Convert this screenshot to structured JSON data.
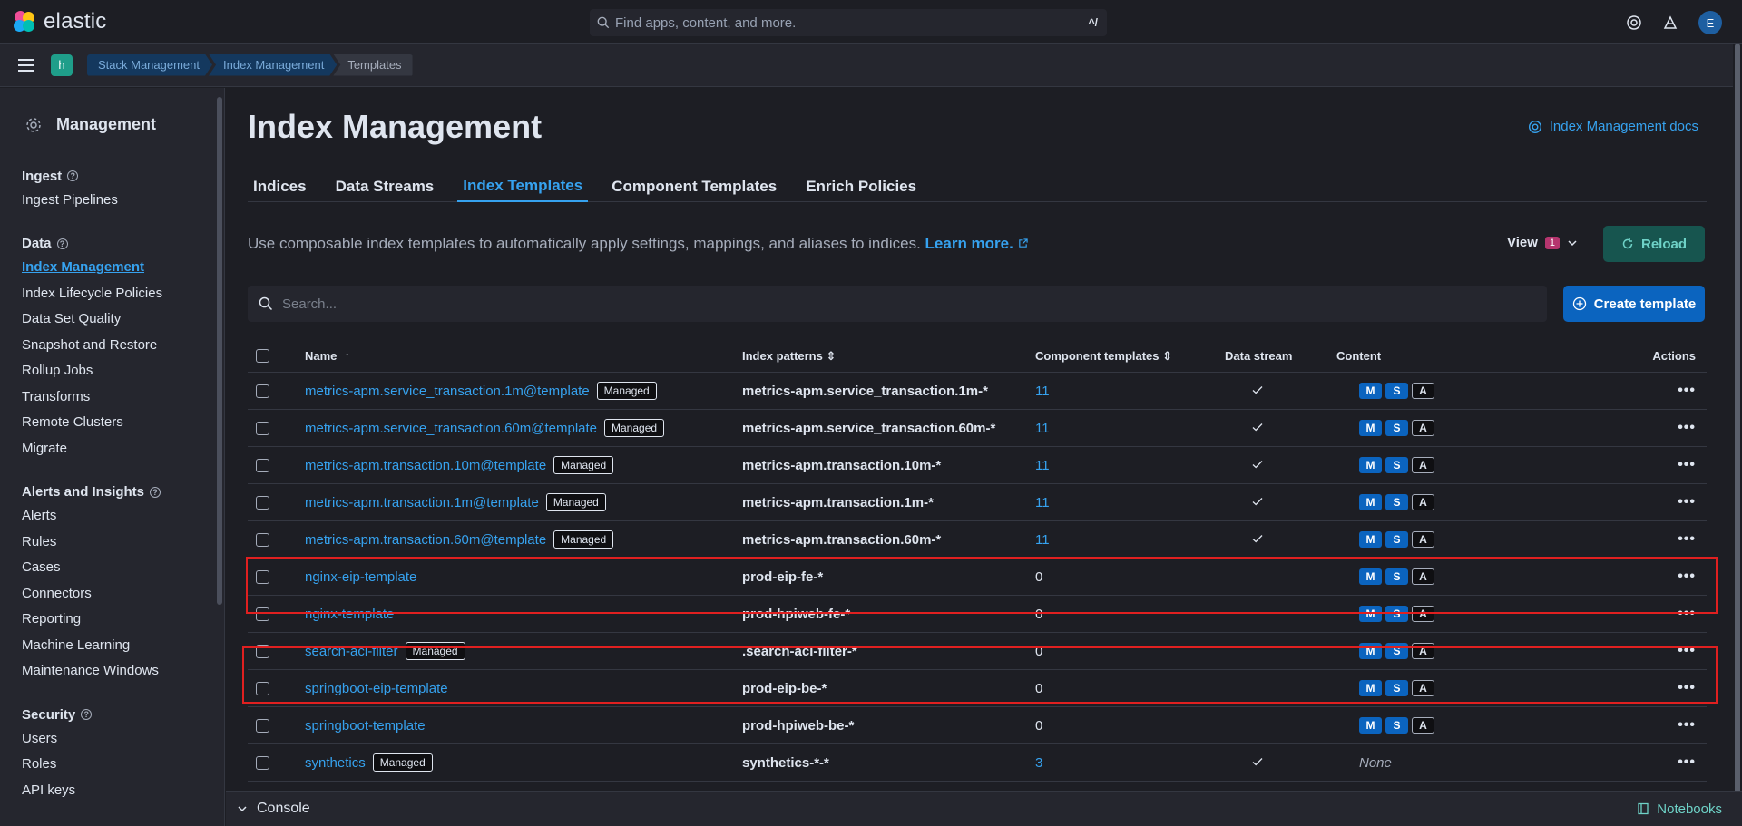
{
  "app": {
    "logo_text": "elastic",
    "search_placeholder": "Find apps, content, and more.",
    "search_shortcut": "^/",
    "avatar_letter": "E",
    "space_letter": "h"
  },
  "breadcrumbs": [
    "Stack Management",
    "Index Management",
    "Templates"
  ],
  "sidenav": {
    "title": "Management",
    "sections": [
      {
        "title": "Ingest",
        "items": [
          "Ingest Pipelines"
        ]
      },
      {
        "title": "Data",
        "items": [
          "Index Management",
          "Index Lifecycle Policies",
          "Data Set Quality",
          "Snapshot and Restore",
          "Rollup Jobs",
          "Transforms",
          "Remote Clusters",
          "Migrate"
        ]
      },
      {
        "title": "Alerts and Insights",
        "items": [
          "Alerts",
          "Rules",
          "Cases",
          "Connectors",
          "Reporting",
          "Machine Learning",
          "Maintenance Windows"
        ]
      },
      {
        "title": "Security",
        "items": [
          "Users",
          "Roles",
          "API keys"
        ]
      }
    ],
    "active_item": "Index Management"
  },
  "page": {
    "title": "Index Management",
    "docs_link": "Index Management docs",
    "tabs": [
      "Indices",
      "Data Streams",
      "Index Templates",
      "Component Templates",
      "Enrich Policies"
    ],
    "active_tab": "Index Templates",
    "description": "Use composable index templates to automatically apply settings, mappings, and aliases to indices.",
    "learn_more": "Learn more.",
    "view_label": "View",
    "view_count": "1",
    "reload_label": "Reload",
    "search_placeholder": "Search...",
    "create_label": "Create template"
  },
  "table": {
    "columns": [
      "Name",
      "Index patterns",
      "Component templates",
      "Data stream",
      "Content",
      "Actions"
    ],
    "rows": [
      {
        "name": "metrics-apm.service_transaction.1m@template",
        "managed": true,
        "pattern": "metrics-apm.service_transaction.1m-*",
        "components": "11",
        "data_stream": true,
        "content": [
          "M",
          "S",
          "A"
        ]
      },
      {
        "name": "metrics-apm.service_transaction.60m@template",
        "managed": true,
        "pattern": "metrics-apm.service_transaction.60m-*",
        "components": "11",
        "data_stream": true,
        "content": [
          "M",
          "S",
          "A"
        ]
      },
      {
        "name": "metrics-apm.transaction.10m@template",
        "managed": true,
        "pattern": "metrics-apm.transaction.10m-*",
        "components": "11",
        "data_stream": true,
        "content": [
          "M",
          "S",
          "A"
        ]
      },
      {
        "name": "metrics-apm.transaction.1m@template",
        "managed": true,
        "pattern": "metrics-apm.transaction.1m-*",
        "components": "11",
        "data_stream": true,
        "content": [
          "M",
          "S",
          "A"
        ]
      },
      {
        "name": "metrics-apm.transaction.60m@template",
        "managed": true,
        "pattern": "metrics-apm.transaction.60m-*",
        "components": "11",
        "data_stream": true,
        "content": [
          "M",
          "S",
          "A"
        ]
      },
      {
        "name": "nginx-eip-template",
        "managed": false,
        "pattern": "prod-eip-fe-*",
        "components": "0",
        "data_stream": false,
        "content": [
          "M",
          "S",
          "A"
        ]
      },
      {
        "name": "nginx-template",
        "managed": false,
        "pattern": "prod-hpiweb-fe-*",
        "components": "0",
        "data_stream": false,
        "content": [
          "M",
          "S",
          "A"
        ]
      },
      {
        "name": "search-acl-filter",
        "managed": true,
        "pattern": ".search-acl-filter-*",
        "components": "0",
        "data_stream": false,
        "content": [
          "M",
          "S",
          "A"
        ]
      },
      {
        "name": "springboot-eip-template",
        "managed": false,
        "pattern": "prod-eip-be-*",
        "components": "0",
        "data_stream": false,
        "content": [
          "M",
          "S",
          "A"
        ]
      },
      {
        "name": "springboot-template",
        "managed": false,
        "pattern": "prod-hpiweb-be-*",
        "components": "0",
        "data_stream": false,
        "content": [
          "M",
          "S",
          "A"
        ]
      },
      {
        "name": "synthetics",
        "managed": true,
        "pattern": "synthetics-*-*",
        "components": "3",
        "data_stream": true,
        "content_none": "None"
      }
    ],
    "managed_label": "Managed",
    "actions_glyph": "•••"
  },
  "footer": {
    "console_label": "Console",
    "notebooks_label": "Notebooks"
  },
  "colors": {
    "accent": "#36a2ef",
    "highlight_box": "#e02020",
    "reload_bg": "#17554f",
    "create_bg": "#0b64bf"
  }
}
